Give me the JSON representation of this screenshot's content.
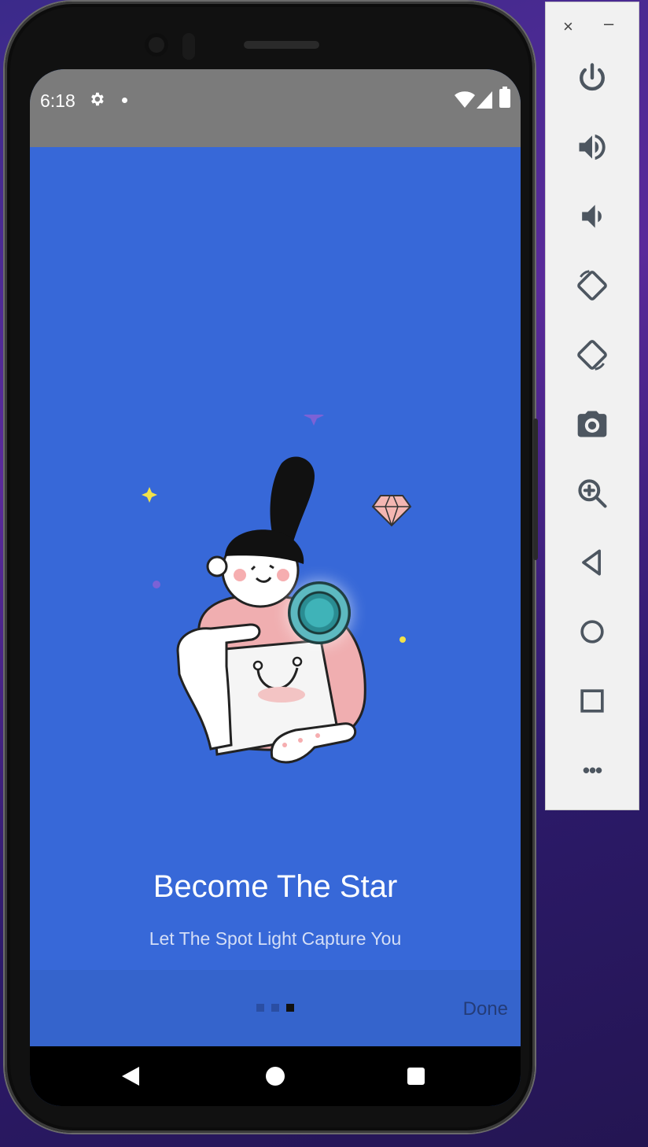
{
  "status_bar": {
    "time": "6:18"
  },
  "onboarding": {
    "title": "Become The Star",
    "subtitle": "Let The Spot Light Capture You",
    "pages": 3,
    "current_page": 3,
    "done_label": "Done"
  },
  "emulator_panel": {
    "close_symbol": "×",
    "minimize_symbol": "–",
    "more_symbol": "•••",
    "buttons": [
      "power-icon",
      "volume-up-icon",
      "volume-down-icon",
      "rotate-left-icon",
      "rotate-right-icon",
      "camera-icon",
      "zoom-icon",
      "back-icon",
      "home-icon",
      "overview-icon",
      "more-icon"
    ]
  },
  "colors": {
    "screen_bg": "#3768d8",
    "bottom_bar": "#3564cc",
    "status_bar": "#7b7b7b",
    "done_text": "#243c78"
  }
}
